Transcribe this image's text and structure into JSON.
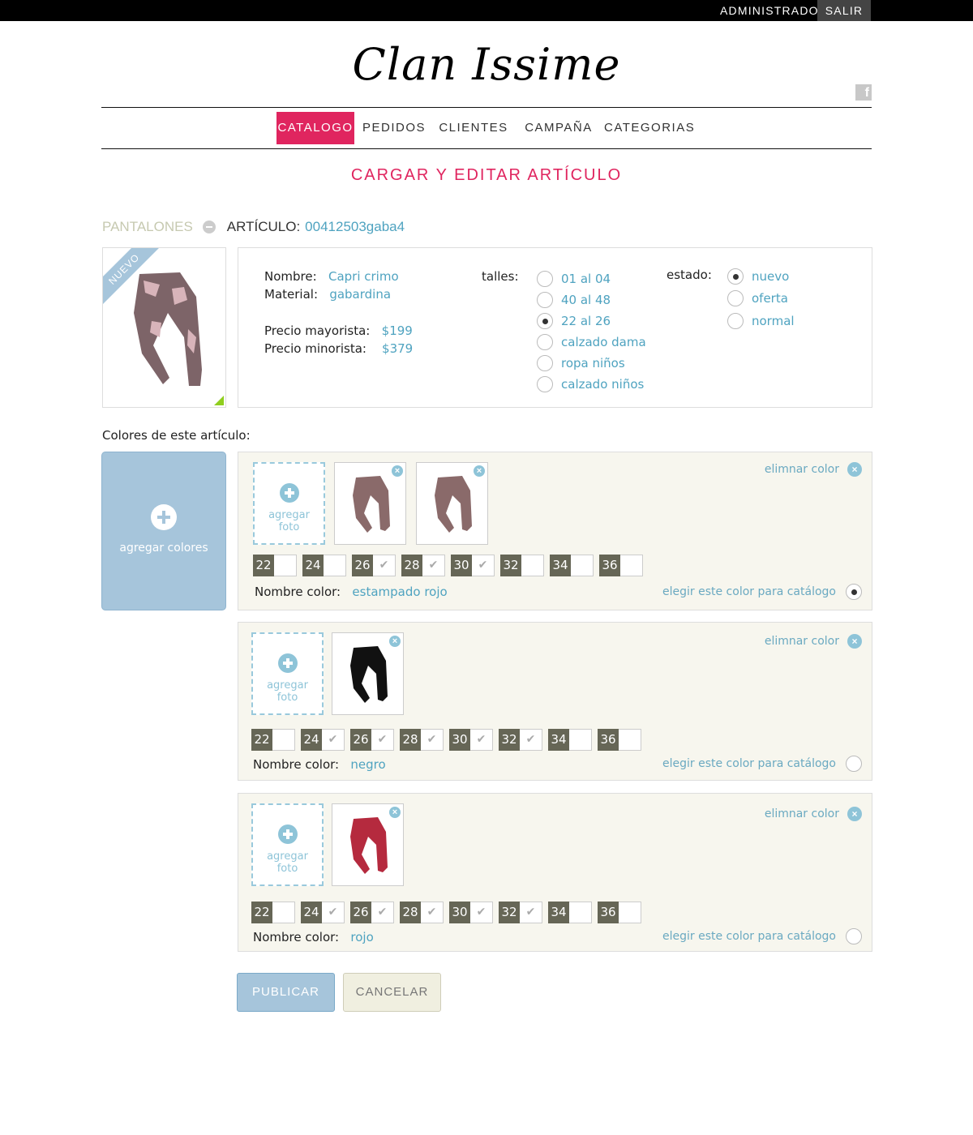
{
  "topbar": {
    "user": "ADMINISTRADOR",
    "logout": "SALIR"
  },
  "brand": {
    "logo": "Clan Issime",
    "social": "f"
  },
  "nav": {
    "items": [
      "CATALOGO",
      "PEDIDOS",
      "CLIENTES",
      "CAMPAÑA",
      "CATEGORIAS"
    ],
    "active": "CATALOGO"
  },
  "page_title": "CARGAR Y EDITAR ARTÍCULO",
  "breadcrumb": {
    "category": "PANTALONES",
    "article_label": "ARTÍCULO:",
    "article_code": "00412503gaba4"
  },
  "product": {
    "badge": "NUEVO",
    "nombre_label": "Nombre:",
    "nombre": "Capri crimo",
    "material_label": "Material:",
    "material": "gabardina",
    "mayorista_label": "Precio mayorista:",
    "mayorista": "$199",
    "minorista_label": "Precio minorista:",
    "minorista": "$379"
  },
  "talles": {
    "label": "talles:",
    "options": [
      "01 al 04",
      "40 al 48",
      "22 al 26",
      "calzado dama",
      "ropa niños",
      "calzado niños"
    ],
    "selected": "22 al 26"
  },
  "estado": {
    "label": "estado:",
    "options": [
      "nuevo",
      "oferta",
      "normal"
    ],
    "selected": "nuevo"
  },
  "colors_section": {
    "heading": "Colores de este artículo:",
    "add_colors": "agregar colores",
    "add_photo_line1": "agregar",
    "add_photo_line2": "foto",
    "remove_color": "elimnar color",
    "choose_catalog": "elegir este color para catálogo",
    "name_label": "Nombre color:",
    "colors": [
      {
        "name": "estampado rojo",
        "swatch": "#8a6a6a",
        "catalog": true,
        "sizes": [
          {
            "n": "22",
            "c": false
          },
          {
            "n": "24",
            "c": false
          },
          {
            "n": "26",
            "c": true
          },
          {
            "n": "28",
            "c": true
          },
          {
            "n": "30",
            "c": true
          },
          {
            "n": "32",
            "c": false
          },
          {
            "n": "34",
            "c": false
          },
          {
            "n": "36",
            "c": false
          }
        ]
      },
      {
        "name": "negro",
        "swatch": "#111111",
        "catalog": false,
        "sizes": [
          {
            "n": "22",
            "c": false
          },
          {
            "n": "24",
            "c": true
          },
          {
            "n": "26",
            "c": true
          },
          {
            "n": "28",
            "c": true
          },
          {
            "n": "30",
            "c": true
          },
          {
            "n": "32",
            "c": true
          },
          {
            "n": "34",
            "c": false
          },
          {
            "n": "36",
            "c": false
          }
        ]
      },
      {
        "name": "rojo",
        "swatch": "#b52a3e",
        "catalog": false,
        "sizes": [
          {
            "n": "22",
            "c": false
          },
          {
            "n": "24",
            "c": true
          },
          {
            "n": "26",
            "c": true
          },
          {
            "n": "28",
            "c": true
          },
          {
            "n": "30",
            "c": true
          },
          {
            "n": "32",
            "c": true
          },
          {
            "n": "34",
            "c": false
          },
          {
            "n": "36",
            "c": false
          }
        ]
      }
    ]
  },
  "actions": {
    "publish": "PUBLICAR",
    "cancel": "CANCELAR"
  },
  "colors": {
    "accent": "#e0255f",
    "link": "#4fa3c0",
    "panel": "#f7f6ee",
    "button_blue": "#a6c5db"
  }
}
